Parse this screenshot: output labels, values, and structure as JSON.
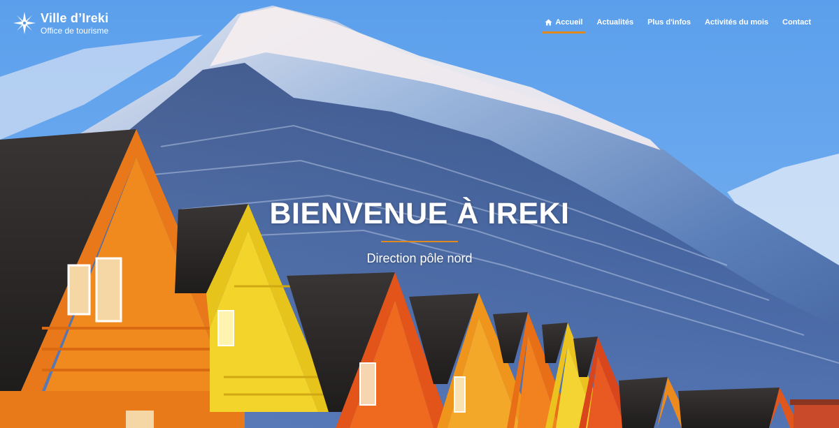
{
  "brand": {
    "title": "Ville d’Ireki",
    "subtitle": "Office de tourisme",
    "icon": "compass-star-icon"
  },
  "nav": {
    "items": [
      {
        "label": "Accueil",
        "icon": "home-icon",
        "active": true
      },
      {
        "label": "Actualités"
      },
      {
        "label": "Plus d'infos"
      },
      {
        "label": "Activités du mois"
      },
      {
        "label": "Contact"
      }
    ]
  },
  "hero": {
    "title": "BIENVENUE À IREKI",
    "subtitle": "Direction pôle nord"
  },
  "colors": {
    "accent": "#e08a1e",
    "sky": "#4f96e8",
    "text": "#ffffff"
  }
}
